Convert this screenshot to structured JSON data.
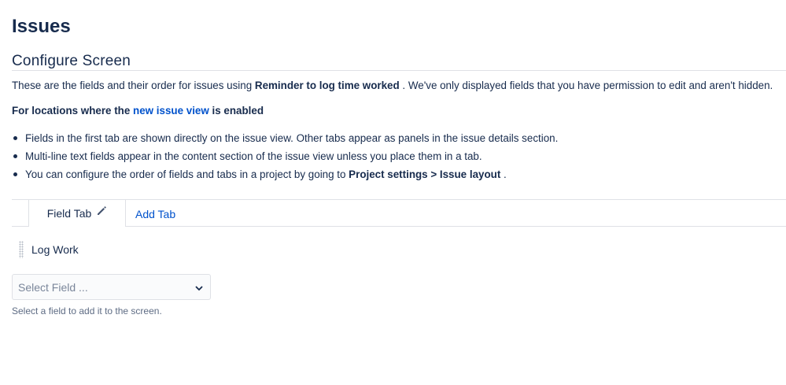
{
  "page": {
    "title": "Issues"
  },
  "section": {
    "title": "Configure Screen",
    "intro_prefix": "These are the fields and their order for issues using ",
    "intro_bold": "Reminder to log time worked",
    "intro_suffix": " . We've only displayed fields that you have permission to edit and aren't hidden."
  },
  "locations": {
    "prefix": "For locations where the ",
    "link": "new issue view",
    "suffix": " is enabled"
  },
  "bullets": {
    "item1": "Fields in the first tab are shown directly on the issue view. Other tabs appear as panels in the issue details section.",
    "item2": "Multi-line text fields appear in the content section of the issue view unless you place them in a tab.",
    "item3_prefix": "You can configure the order of fields and tabs in a project by going to ",
    "item3_bold": "Project settings > Issue layout",
    "item3_suffix": " ."
  },
  "tabs": {
    "active_label": "Field Tab",
    "active_icon": "pencil-icon",
    "add_label": "Add Tab"
  },
  "fields": [
    {
      "name": "Log Work"
    }
  ],
  "select": {
    "placeholder": "Select Field ...",
    "helper": "Select a field to add it to the screen."
  },
  "colors": {
    "text": "#172b4d",
    "link": "#0052cc",
    "border": "#dfe1e6",
    "muted": "#5e6c84",
    "placeholder": "#7a869a"
  }
}
